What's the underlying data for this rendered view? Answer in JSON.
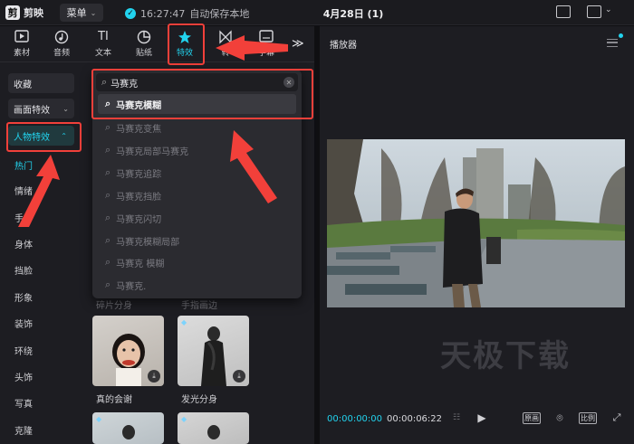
{
  "app": {
    "name": "剪映",
    "logo_glyph": "剪"
  },
  "titlebar": {
    "menu_label": "菜单",
    "save_time": "16:27:47",
    "save_text": "自动保存本地",
    "doc_title": "4月28日 (1)"
  },
  "toolbar": {
    "tools": [
      {
        "label": "素材",
        "icon": "media-icon",
        "glyph": "▣"
      },
      {
        "label": "音频",
        "icon": "audio-icon",
        "glyph": "♪"
      },
      {
        "label": "文本",
        "icon": "text-icon",
        "glyph": "TI"
      },
      {
        "label": "贴纸",
        "icon": "sticker-icon",
        "glyph": "◔"
      },
      {
        "label": "特效",
        "icon": "effects-icon",
        "glyph": "✦"
      },
      {
        "label": "转",
        "icon": "transition-icon",
        "glyph": "⋈"
      },
      {
        "label": "字幕",
        "icon": "caption-icon",
        "glyph": "▤"
      }
    ],
    "more_glyph": "≫",
    "active_tool": "特效"
  },
  "sidebar": {
    "favorites": "收藏",
    "screen_effects": "画面特效",
    "person_effects": "人物特效",
    "items": [
      "热门",
      "情绪",
      "手部",
      "身体",
      "挡脸",
      "形象",
      "装饰",
      "环绕",
      "头饰",
      "写真",
      "克隆"
    ],
    "active_item": "热门"
  },
  "search": {
    "value": "马赛克",
    "suggestions": [
      "马赛克模糊",
      "马赛克变焦",
      "马赛克局部马赛克",
      "马赛克追踪",
      "马赛克挡脸",
      "马赛克闪切",
      "马赛克模糊局部",
      "马赛克 模糊",
      "马赛克."
    ]
  },
  "effects_grid": {
    "partial_labels": [
      "碎片分身",
      "手指画边"
    ],
    "items": [
      {
        "label": "真的会谢"
      },
      {
        "label": "发光分身"
      }
    ]
  },
  "player": {
    "title": "播放器",
    "current_time": "00:00:00:00",
    "total_time": "00:00:06:22",
    "btn_original": "原画",
    "btn_ratio": "比例",
    "watermark": "天极下载"
  },
  "colors": {
    "accent": "#22d3ee",
    "highlight": "#f2403a",
    "panel": "#1d1d22"
  }
}
